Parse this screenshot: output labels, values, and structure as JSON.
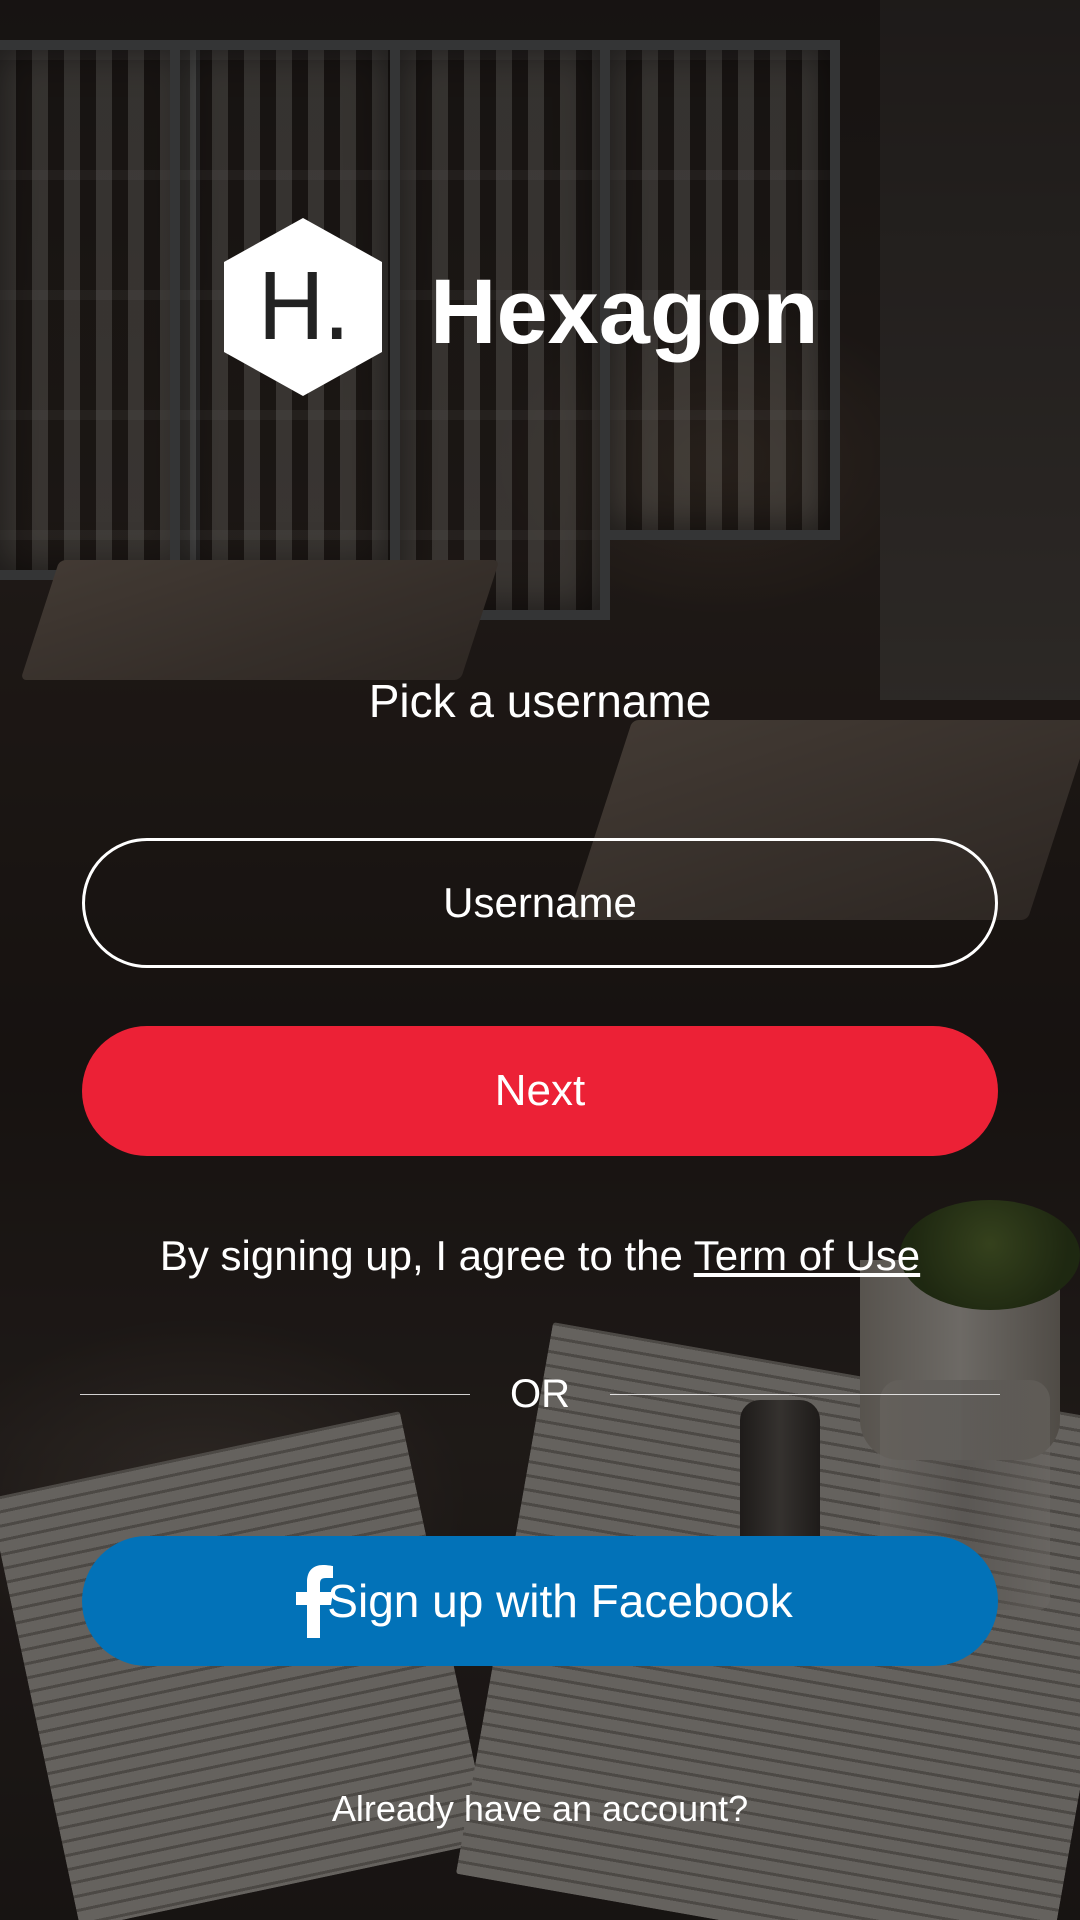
{
  "brand": {
    "logo_letter": "H.",
    "name": "Hexagon"
  },
  "form": {
    "prompt": "Pick a username",
    "username_placeholder": "Username",
    "username_value": "",
    "next_label": "Next"
  },
  "terms": {
    "prefix": "By signing up, I agree to the ",
    "link_label": "Term of Use"
  },
  "separator_label": "OR",
  "facebook": {
    "label": "Sign up with Facebook",
    "icon": "facebook-icon"
  },
  "login_prompt": "Already have an account?",
  "colors": {
    "next_button": "#ec2136",
    "facebook_button": "#0272b8",
    "text": "#ffffff"
  }
}
